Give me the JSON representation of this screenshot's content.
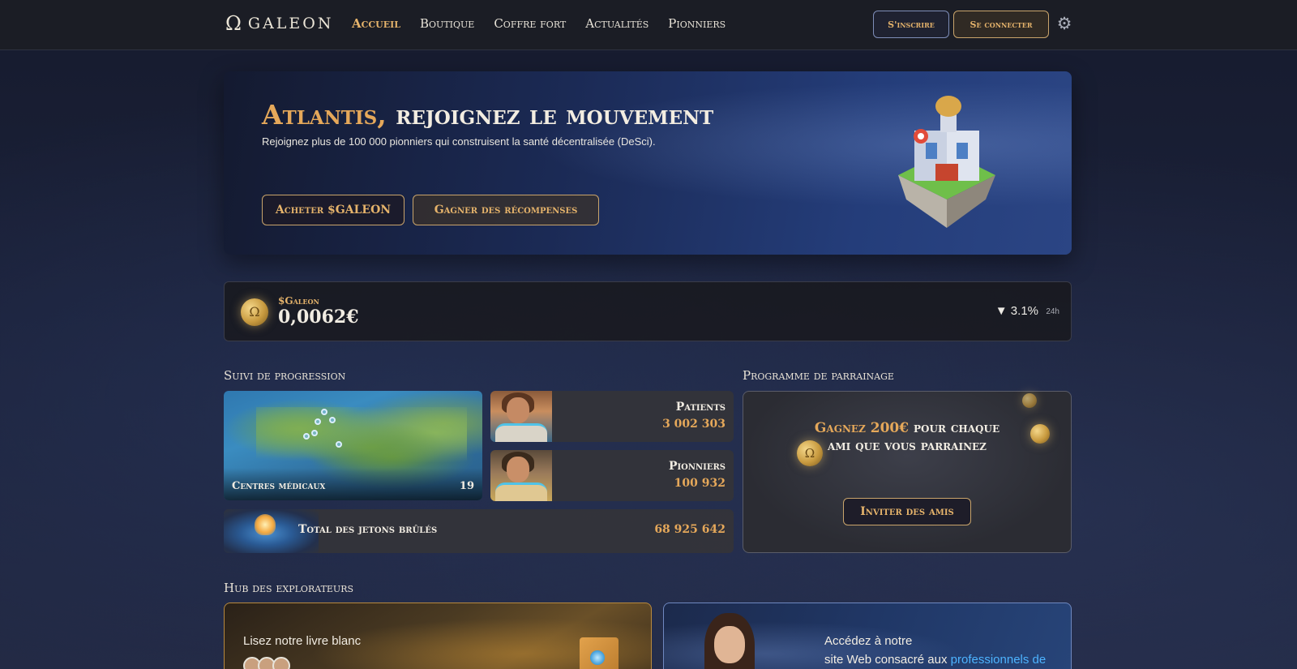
{
  "brand": {
    "symbol": "Ω",
    "name": "GALEON"
  },
  "nav": {
    "items": [
      {
        "label": "Accueil",
        "active": true
      },
      {
        "label": "Boutique",
        "active": false
      },
      {
        "label": "Coffre fort",
        "active": false
      },
      {
        "label": "Actualités",
        "active": false
      },
      {
        "label": "Pionniers",
        "active": false
      }
    ],
    "signup_label": "S'inscrire",
    "login_label": "Se connecter",
    "settings_icon": "gear-icon"
  },
  "hero": {
    "title_accent": "Atlantis,",
    "title_rest": " rejoignez le mouvement",
    "subtitle": "Rejoignez plus de 100 000 pionniers qui construisent la santé décentralisée (DeSci).",
    "buy_label": "Acheter $GALEON",
    "earn_label": "Gagner des récompenses"
  },
  "token": {
    "coin_symbol": "Ω",
    "label": "$Galeon",
    "price": "0,0062€",
    "change": "▼ 3.1%",
    "period": "24h",
    "trend": "down"
  },
  "progress": {
    "title": "Suivi de progression",
    "medical_centers": {
      "label": "Centres médicaux",
      "value": "19"
    },
    "patients": {
      "label": "Patients",
      "value": "3 002 303"
    },
    "pioneers": {
      "label": "Pionniers",
      "value": "100 932"
    },
    "burned": {
      "label": "Total des jetons brûlés",
      "value": "68 925 642"
    }
  },
  "referral": {
    "title": "Programme de parrainage",
    "text_accent": "Gagnez 200€",
    "text_rest": " pour chaque ami que vous parrainez",
    "button_label": "Inviter des amis"
  },
  "hub": {
    "title": "Hub des explorateurs",
    "whitepaper_text": "Lisez notre livre blanc",
    "site_text_1": "Accédez à notre",
    "site_text_2": "site Web consacré aux ",
    "site_link": "professionnels de"
  },
  "colors": {
    "accent_gold": "#e5b36b",
    "accent_orange": "#e5a85a",
    "link_blue": "#4db3ff"
  }
}
